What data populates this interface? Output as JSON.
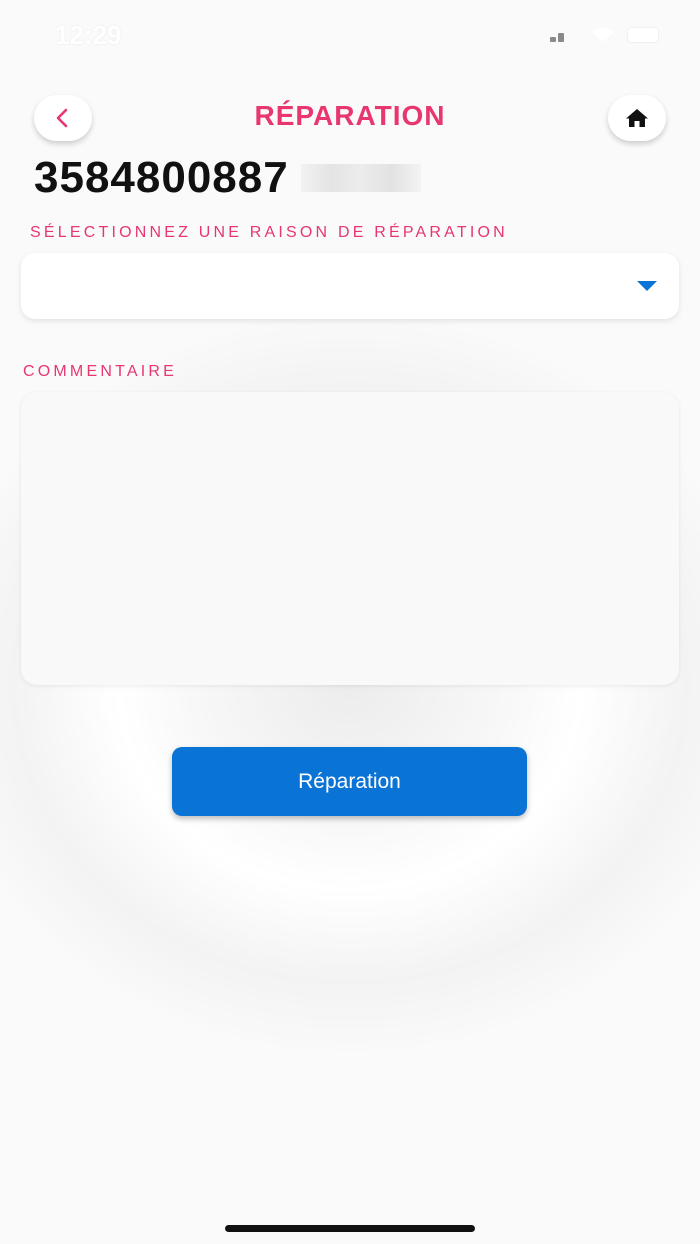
{
  "status": {
    "time": "12:29"
  },
  "header": {
    "title": "RÉPARATION",
    "back_icon": "chevron-left-icon",
    "home_icon": "home-icon"
  },
  "device": {
    "number": "3584800887"
  },
  "form": {
    "reason_label": "SÉLECTIONNEZ UNE RAISON DE RÉPARATION",
    "reason_value": "",
    "comment_label": "COMMENTAIRE",
    "comment_value": "",
    "submit_label": "Réparation"
  },
  "colors": {
    "accent": "#e8366f",
    "primary": "#0a73d6"
  }
}
